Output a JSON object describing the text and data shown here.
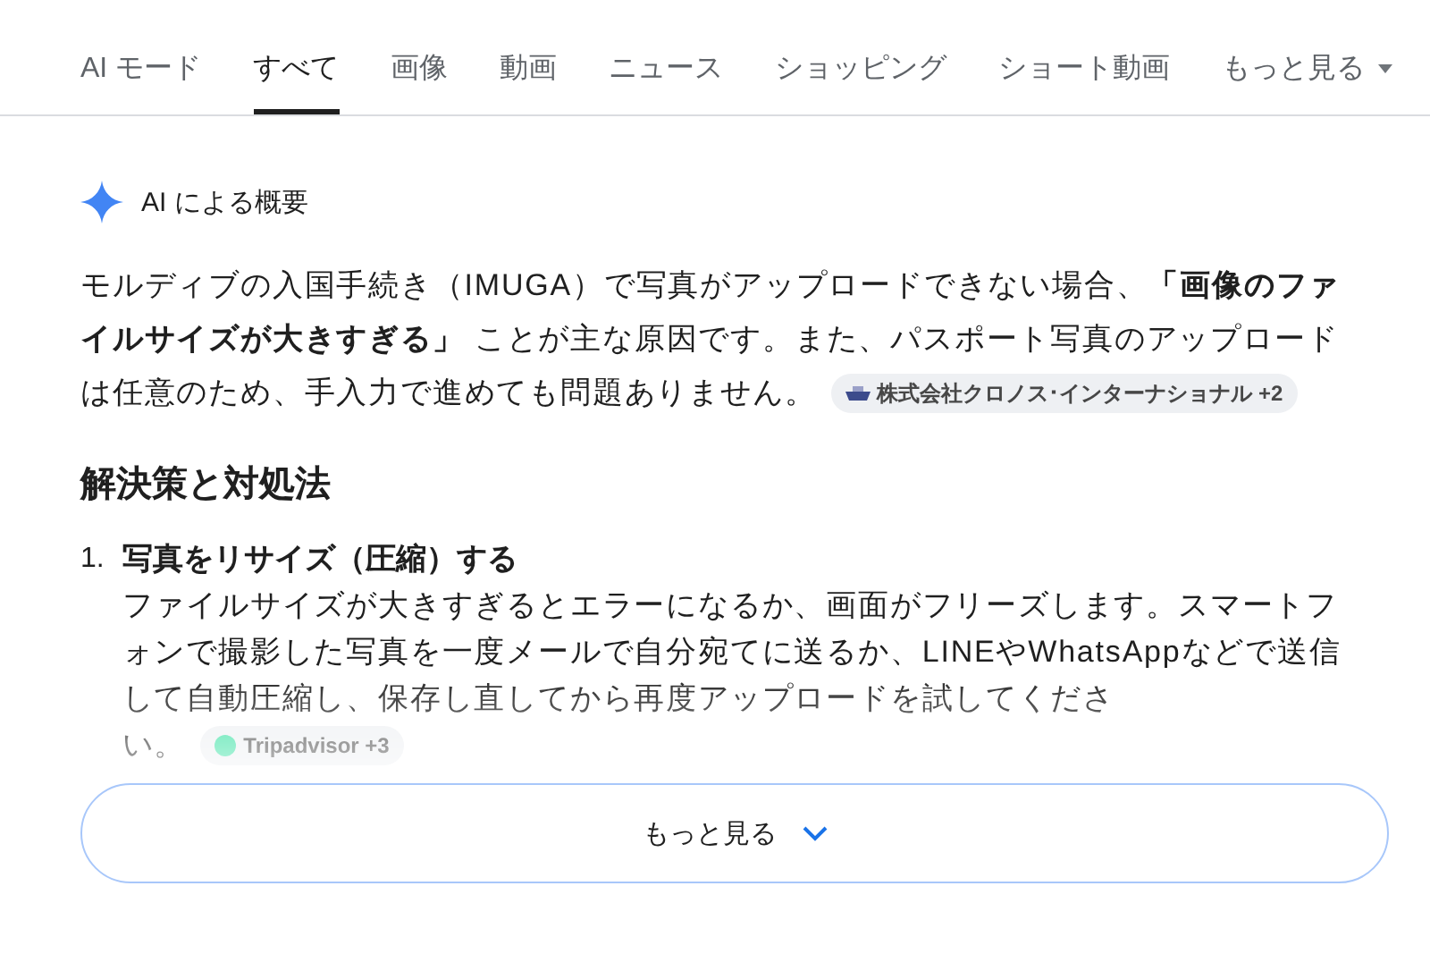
{
  "tabs": [
    {
      "label": "AI モード",
      "selected": false
    },
    {
      "label": "すべて",
      "selected": true
    },
    {
      "label": "画像",
      "selected": false
    },
    {
      "label": "動画",
      "selected": false
    },
    {
      "label": "ニュース",
      "selected": false
    },
    {
      "label": "ショッピング",
      "selected": false
    },
    {
      "label": "ショート動画",
      "selected": false
    },
    {
      "label": "もっと見る",
      "selected": false,
      "dropdown": true
    }
  ],
  "overview": {
    "title": "AI による概要",
    "summary": "モルディブの入国手続き（IMUGA）で写真がアップロードできない場合、**「画像のファイルサイズが大きすぎる」** ことが主な原因です。また、パスポート写真のアップロード",
    "summary_end": "は任意のため、手入力で進めても問題ありません。",
    "summary_source": "株式会社クロノス･インターナショナル +2",
    "heading": "解決策と対処法",
    "steps": [
      {
        "number": "1.",
        "title": "写真をリサイズ（圧縮）する",
        "body": "ファイルサイズが大きすぎるとエラーになるか、画面がフリーズします。スマートフォンで撮影した写真を一度メールで自分宛てに送るか、LINEやWhatsAppなどで送信して自動圧縮し、保存し直してから再度アップロードを試してくださ",
        "body_end": "い。",
        "source": "Tripadvisor +3"
      }
    ],
    "more_button": "もっと見る"
  }
}
